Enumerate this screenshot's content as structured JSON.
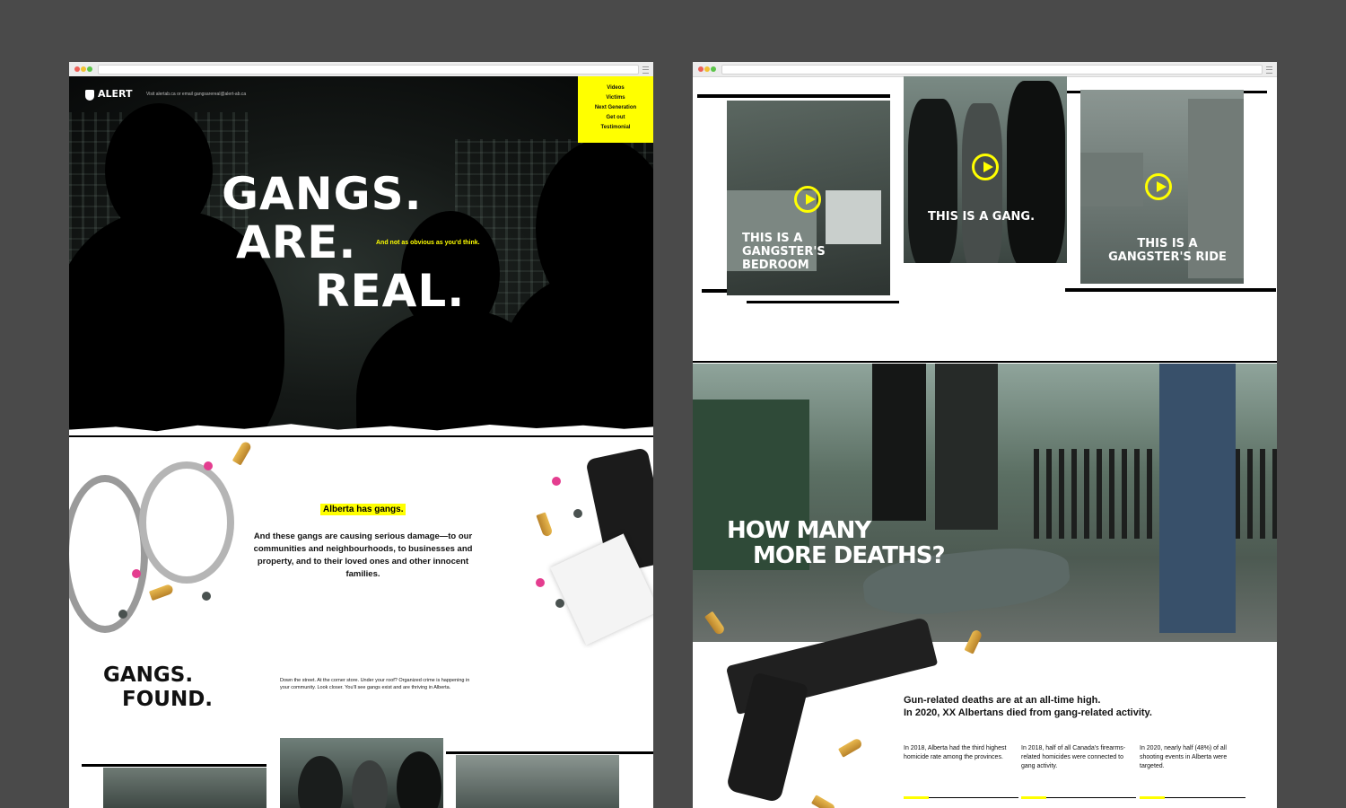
{
  "left_page": {
    "brand": "ALERT",
    "contact": "Visit alertab.ca or email gangsarereal@alert-ab.ca",
    "nav": [
      "Videos",
      "Victims",
      "Next Generation",
      "Get out",
      "Testimonial"
    ],
    "hero": {
      "line1": "GANGS.",
      "line2": "ARE.",
      "line3": "REAL.",
      "tagline": "And not as obvious as you'd think."
    },
    "intro": {
      "highlight": "Alberta has gangs.",
      "body": "And these gangs are causing serious damage—to our communities and neighbourhoods, to businesses and property, and to their loved ones and other innocent families."
    },
    "found": {
      "line1": "GANGS.",
      "line2": "FOUND.",
      "body": "Down the street. At the corner store. Under your roof? Organized crime is happening in your community. Look closer. You'll see gangs exist and are thriving in Alberta."
    }
  },
  "right_page": {
    "videos": [
      {
        "caption": "THIS IS A GANGSTER'S BEDROOM",
        "icon": "play-icon"
      },
      {
        "caption": "THIS IS A GANG.",
        "icon": "play-icon"
      },
      {
        "caption": "THIS IS A GANGSTER'S RIDE",
        "icon": "play-icon"
      }
    ],
    "deaths_headline_1": "HOW MANY",
    "deaths_headline_2": "MORE DEATHS?",
    "stat_heading_1": "Gun-related deaths are at an all-time high.",
    "stat_heading_2": "In 2020, XX Albertans died from gang-related activity.",
    "stats": [
      "In 2018, Alberta had the third highest homicide rate among the provinces.",
      "In 2018, half of all Canada's firearms-related homicides were connected to gang activity.",
      "In 2020, nearly half (48%) of all shooting events in Alberta were targeted."
    ]
  },
  "colors": {
    "accent": "#ffff00",
    "background": "#4a4a4a",
    "hero_dark": "#0b0d0c"
  }
}
